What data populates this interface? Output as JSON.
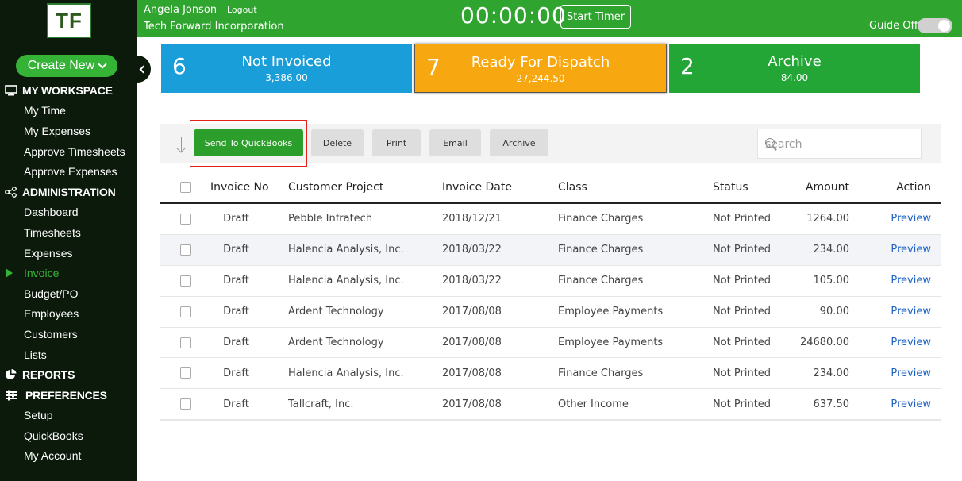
{
  "sidebar": {
    "logo_text": "TF",
    "create_new_label": "Create New",
    "workspace_label": "MY WORKSPACE",
    "workspace_items": [
      "My Time",
      "My Expenses",
      "Approve Timesheets",
      "Approve Expenses"
    ],
    "admin_label": "ADMINISTRATION",
    "admin_items": [
      "Dashboard",
      "Timesheets",
      "Expenses",
      "Invoice",
      "Budget/PO",
      "Employees",
      "Customers",
      "Lists"
    ],
    "active_item": "Invoice",
    "reports_label": "REPORTS",
    "preferences_label": "PREFERENCES",
    "preferences_items": [
      "Setup",
      "QuickBooks",
      "My Account"
    ]
  },
  "header": {
    "user_name": "Angela Jonson",
    "logout_label": "Logout",
    "company": "Tech Forward Incorporation",
    "timer": "00:00:00",
    "start_timer_label": "Start Timer",
    "guide_label": "Guide Off"
  },
  "cards": [
    {
      "count": "6",
      "title": "Not Invoiced",
      "amount": "3,386.00",
      "color": "#1a9ed9"
    },
    {
      "count": "7",
      "title": "Ready For Dispatch",
      "amount": "27,244.50",
      "color": "#f7a70f"
    },
    {
      "count": "2",
      "title": "Archive",
      "amount": "84.00",
      "color": "#24a637"
    }
  ],
  "toolbar": {
    "send_label": "Send To QuickBooks",
    "delete_label": "Delete",
    "print_label": "Print",
    "email_label": "Email",
    "archive_label": "Archive",
    "search_placeholder": "search"
  },
  "table": {
    "headers": {
      "invoice_no": "Invoice No",
      "customer": "Customer Project",
      "date": "Invoice Date",
      "class": "Class",
      "status": "Status",
      "amount": "Amount",
      "action": "Action"
    },
    "rows": [
      {
        "no": "Draft",
        "customer": "Pebble Infratech",
        "date": "2018/12/21",
        "class": "Finance Charges",
        "status": "Not Printed",
        "amount": "1264.00",
        "action": "Preview"
      },
      {
        "no": "Draft",
        "customer": "Halencia Analysis, Inc.",
        "date": "2018/03/22",
        "class": "Finance Charges",
        "status": "Not Printed",
        "amount": "234.00",
        "action": "Preview"
      },
      {
        "no": "Draft",
        "customer": "Halencia Analysis, Inc.",
        "date": "2018/03/22",
        "class": "Finance Charges",
        "status": "Not Printed",
        "amount": "105.00",
        "action": "Preview"
      },
      {
        "no": "Draft",
        "customer": "Ardent Technology",
        "date": "2017/08/08",
        "class": "Employee Payments",
        "status": "Not Printed",
        "amount": "90.00",
        "action": "Preview"
      },
      {
        "no": "Draft",
        "customer": "Ardent Technology",
        "date": "2017/08/08",
        "class": "Employee Payments",
        "status": "Not Printed",
        "amount": "24680.00",
        "action": "Preview"
      },
      {
        "no": "Draft",
        "customer": "Halencia Analysis, Inc.",
        "date": "2017/08/08",
        "class": "Finance Charges",
        "status": "Not Printed",
        "amount": "234.00",
        "action": "Preview"
      },
      {
        "no": "Draft",
        "customer": "Tallcraft, Inc.",
        "date": "2017/08/08",
        "class": "Other Income",
        "status": "Not Printed",
        "amount": "637.50",
        "action": "Preview"
      }
    ]
  }
}
